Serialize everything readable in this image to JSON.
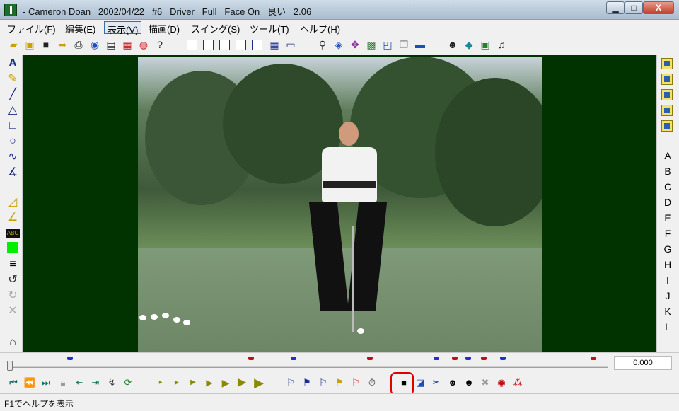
{
  "window": {
    "title": "- Cameron Doan   2002/04/22   #6   Driver   Full   Face On   良い   2.06",
    "min": "▁",
    "max": "□",
    "close": "X"
  },
  "menu": {
    "items": [
      {
        "label": "ファイル(F)"
      },
      {
        "label": "編集(E)"
      },
      {
        "label": "表示(V)"
      },
      {
        "label": "描画(D)"
      },
      {
        "label": "スイング(S)"
      },
      {
        "label": "ツール(T)"
      },
      {
        "label": "ヘルプ(H)"
      }
    ]
  },
  "right_panel": {
    "letters": [
      "A",
      "B",
      "C",
      "D",
      "E",
      "F",
      "G",
      "H",
      "I",
      "J",
      "K",
      "L"
    ]
  },
  "timeline": {
    "time": "0.000",
    "marker_colors": {
      "blue": "#1f2fd0",
      "red": "#c01010"
    }
  },
  "status": {
    "text": "F1でヘルプを表示"
  },
  "colors": {
    "video_background": "#003300",
    "highlight": "#e00000"
  }
}
